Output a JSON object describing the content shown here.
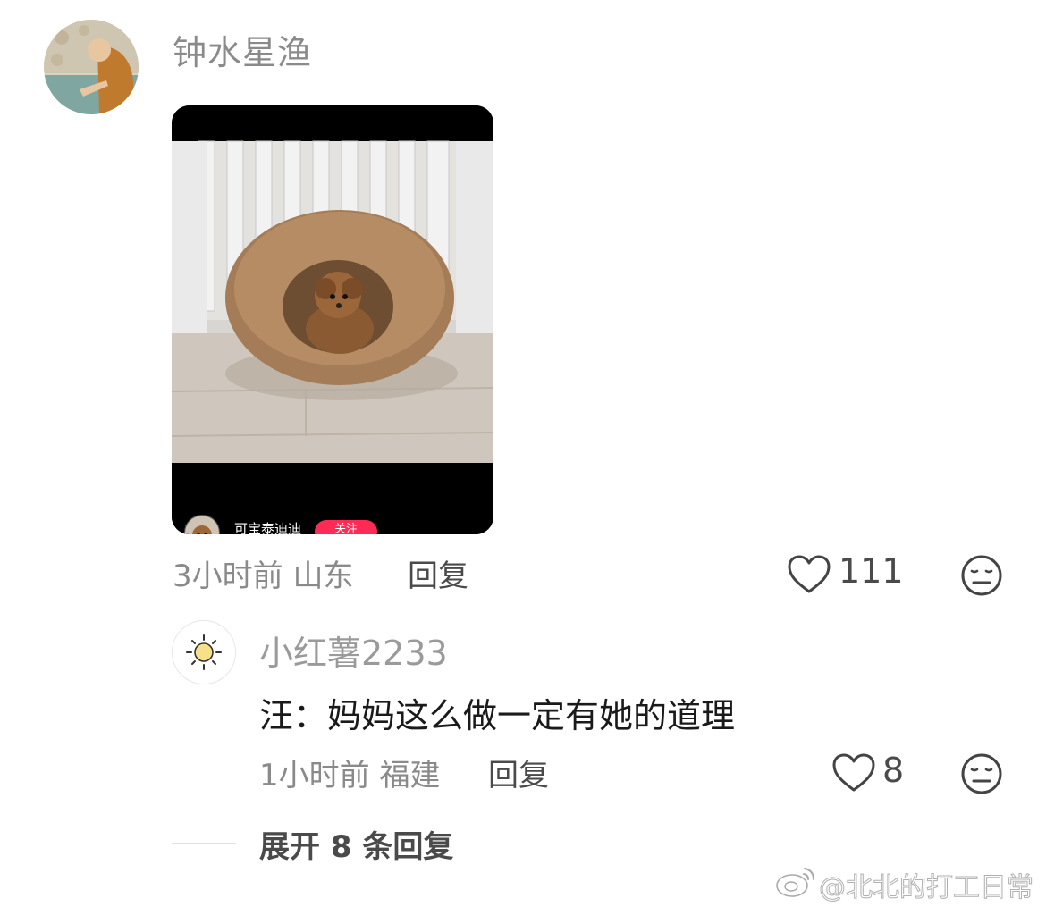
{
  "comment": {
    "username": "钟水星渔",
    "time": "3小时前",
    "location": "山东",
    "reply_label": "回复",
    "like_count": "111",
    "video": {
      "author": "可宝泰迪迪",
      "follow_label": "关注"
    }
  },
  "reply": {
    "username": "小红薯2233",
    "content": "汪：妈妈这么做一定有她的道理",
    "time": "1小时前",
    "location": "福建",
    "reply_label": "回复",
    "like_count": "8"
  },
  "expand": {
    "label": "展开 8 条回复"
  },
  "watermark": {
    "text": "@北北的打工日常"
  },
  "icons": {
    "like": "heart-outline-icon",
    "dislike": "neutral-face-icon",
    "weibo": "weibo-logo-icon"
  },
  "colors": {
    "muted_text": "#8a8a8a",
    "body_text": "#1a1a1a",
    "follow_button": "#fe2c55"
  }
}
